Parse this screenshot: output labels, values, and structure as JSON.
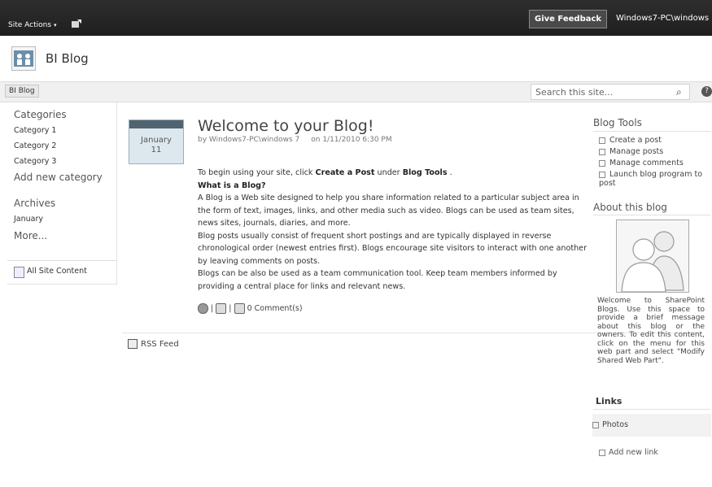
{
  "topbar": {
    "site_actions_label": "Site Actions",
    "site_actions_arrow": "▾",
    "feedback_label": "Give Feedback",
    "user_name": "Windows7-PC\\windows"
  },
  "site": {
    "title": "BI Blog"
  },
  "nav": {
    "tab_label": "BI Blog",
    "search_placeholder": "Search this site...",
    "search_icon": "⌕",
    "help_icon": "?"
  },
  "left_nav": {
    "categories_heading": "Categories",
    "categories": [
      "Category 1",
      "Category 2",
      "Category 3"
    ],
    "add_category": "Add new category",
    "archives_heading": "Archives",
    "archive_month": "January",
    "more_link": "More...",
    "all_site_content": "All Site Content"
  },
  "post": {
    "date_month": "January",
    "date_day": "11",
    "title": "Welcome to your Blog!",
    "by": "by",
    "author": "Windows7-PC\\windows 7",
    "posted_on": "on 1/11/2010 6:30 PM",
    "intro_pre": "To begin using your site, click",
    "intro_create": "Create a Post",
    "intro_mid": "under",
    "intro_tools": "Blog Tools",
    "intro_end": ".",
    "what_heading": "What is a Blog?",
    "para1": "A Blog is a Web site designed to help you share information related to a particular subject area in the form of text, images, links, and other media such as video. Blogs can be used as team sites, news sites, journals, diaries, and more.",
    "para2": "Blog posts usually consist of frequent short postings and are typically displayed in reverse chronological order (newest entries first). Blogs encourage site visitors to interact with one another by leaving comments on posts.",
    "para3": "Blogs can be also be used as a team communication tool. Keep team members informed by providing a central place for links and relevant news.",
    "separator": "|",
    "comments": "0 Comment(s)"
  },
  "rss": {
    "label": "RSS Feed"
  },
  "right": {
    "tools_heading": "Blog Tools",
    "tools": [
      "Create a post",
      "Manage posts",
      "Manage comments",
      "Launch blog program to post"
    ],
    "about_heading": "About this blog",
    "about_text": "Welcome to SharePoint Blogs. Use this space to provide a brief message about this blog or the owners. To edit this content, click on the menu for this web part and select \"Modify Shared Web Part\".",
    "links_heading": "Links",
    "links": [
      "Photos"
    ],
    "add_link": "Add new link"
  }
}
